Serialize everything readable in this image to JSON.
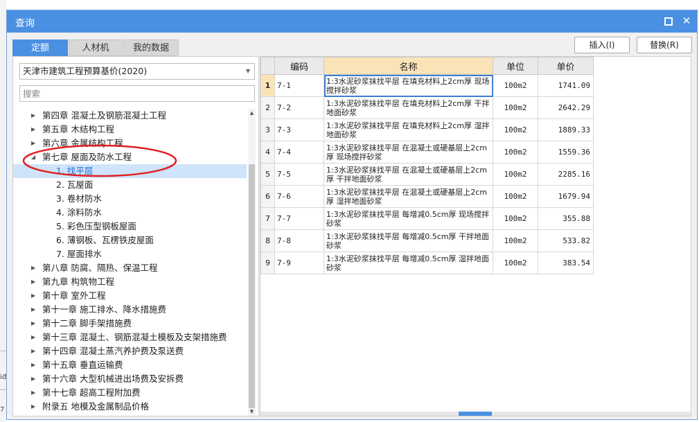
{
  "window": {
    "title": "查询"
  },
  "tabs": [
    {
      "label": "定额",
      "active": true
    },
    {
      "label": "人材机",
      "active": false
    },
    {
      "label": "我的数据",
      "active": false
    }
  ],
  "buttons": {
    "insert": "插入(I)",
    "replace": "替换(R)"
  },
  "left": {
    "library": "天津市建筑工程预算基价(2020)",
    "search_placeholder": "搜索",
    "tree": [
      {
        "label": "第四章 混凝土及钢筋混凝土工程",
        "level": 0,
        "expanded": false
      },
      {
        "label": "第五章 木结构工程",
        "level": 0,
        "expanded": false
      },
      {
        "label": "第六章 金属结构工程",
        "level": 0,
        "expanded": false
      },
      {
        "label": "第七章 屋面及防水工程",
        "level": 0,
        "expanded": true
      },
      {
        "label": "1. 找平层",
        "level": 1,
        "selected": true
      },
      {
        "label": "2. 瓦屋面",
        "level": 1
      },
      {
        "label": "3. 卷材防水",
        "level": 1
      },
      {
        "label": "4. 涂料防水",
        "level": 1
      },
      {
        "label": "5. 彩色压型钢板屋面",
        "level": 1
      },
      {
        "label": "6. 薄钢板、瓦楞铁皮屋面",
        "level": 1
      },
      {
        "label": "7. 屋面排水",
        "level": 1
      },
      {
        "label": "第八章 防腐、隔热、保温工程",
        "level": 0,
        "expanded": false
      },
      {
        "label": "第九章 构筑物工程",
        "level": 0,
        "expanded": false
      },
      {
        "label": "第十章 室外工程",
        "level": 0,
        "expanded": false
      },
      {
        "label": "第十一章 施工排水、降水措施费",
        "level": 0,
        "expanded": false
      },
      {
        "label": "第十二章 脚手架措施费",
        "level": 0,
        "expanded": false
      },
      {
        "label": "第十三章 混凝土、钢筋混凝土模板及支架措施费",
        "level": 0,
        "expanded": false
      },
      {
        "label": "第十四章 混凝土蒸汽养护费及泵送费",
        "level": 0,
        "expanded": false
      },
      {
        "label": "第十五章 垂直运输费",
        "level": 0,
        "expanded": false
      },
      {
        "label": "第十六章 大型机械进出场费及安拆费",
        "level": 0,
        "expanded": false
      },
      {
        "label": "第十七章 超高工程附加费",
        "level": 0,
        "expanded": false
      },
      {
        "label": "附录五 地模及金属制品价格",
        "level": 0,
        "expanded": false
      }
    ],
    "annotation_color": "#e02020"
  },
  "table": {
    "headers": [
      "编码",
      "名称",
      "单位",
      "单价"
    ],
    "rows": [
      {
        "idx": "1",
        "code": "7-1",
        "name": "1:3水泥砂浆抹找平层 在填充材料上2cm厚 现场搅拌砂浆",
        "unit": "100m2",
        "price": "1741.09",
        "selected": true
      },
      {
        "idx": "2",
        "code": "7-2",
        "name": "1:3水泥砂浆抹找平层 在填充材料上2cm厚 干拌地面砂浆",
        "unit": "100m2",
        "price": "2642.29"
      },
      {
        "idx": "3",
        "code": "7-3",
        "name": "1:3水泥砂浆抹找平层 在填充材料上2cm厚 湿拌地面砂浆",
        "unit": "100m2",
        "price": "1889.33"
      },
      {
        "idx": "4",
        "code": "7-4",
        "name": "1:3水泥砂浆抹找平层 在混凝土或硬基层上2cm厚 现场搅拌砂浆",
        "unit": "100m2",
        "price": "1559.36"
      },
      {
        "idx": "5",
        "code": "7-5",
        "name": "1:3水泥砂浆抹找平层 在混凝土或硬基层上2cm厚 干拌地面砂浆",
        "unit": "100m2",
        "price": "2285.16"
      },
      {
        "idx": "6",
        "code": "7-6",
        "name": "1:3水泥砂浆抹找平层 在混凝土或硬基层上2cm厚 湿拌地面砂浆",
        "unit": "100m2",
        "price": "1679.94"
      },
      {
        "idx": "7",
        "code": "7-7",
        "name": "1:3水泥砂浆抹找平层 每增减0.5cm厚 现场搅拌砂浆",
        "unit": "100m2",
        "price": "355.88"
      },
      {
        "idx": "8",
        "code": "7-8",
        "name": "1:3水泥砂浆抹找平层 每增减0.5cm厚 干拌地面砂浆",
        "unit": "100m2",
        "price": "533.82"
      },
      {
        "idx": "9",
        "code": "7-9",
        "name": "1:3水泥砂浆抹找平层 每增减0.5cm厚 湿拌地面砂浆",
        "unit": "100m2",
        "price": "383.54"
      }
    ]
  },
  "edge": {
    "glyph_1": "iđ",
    "glyph_2": "7"
  }
}
